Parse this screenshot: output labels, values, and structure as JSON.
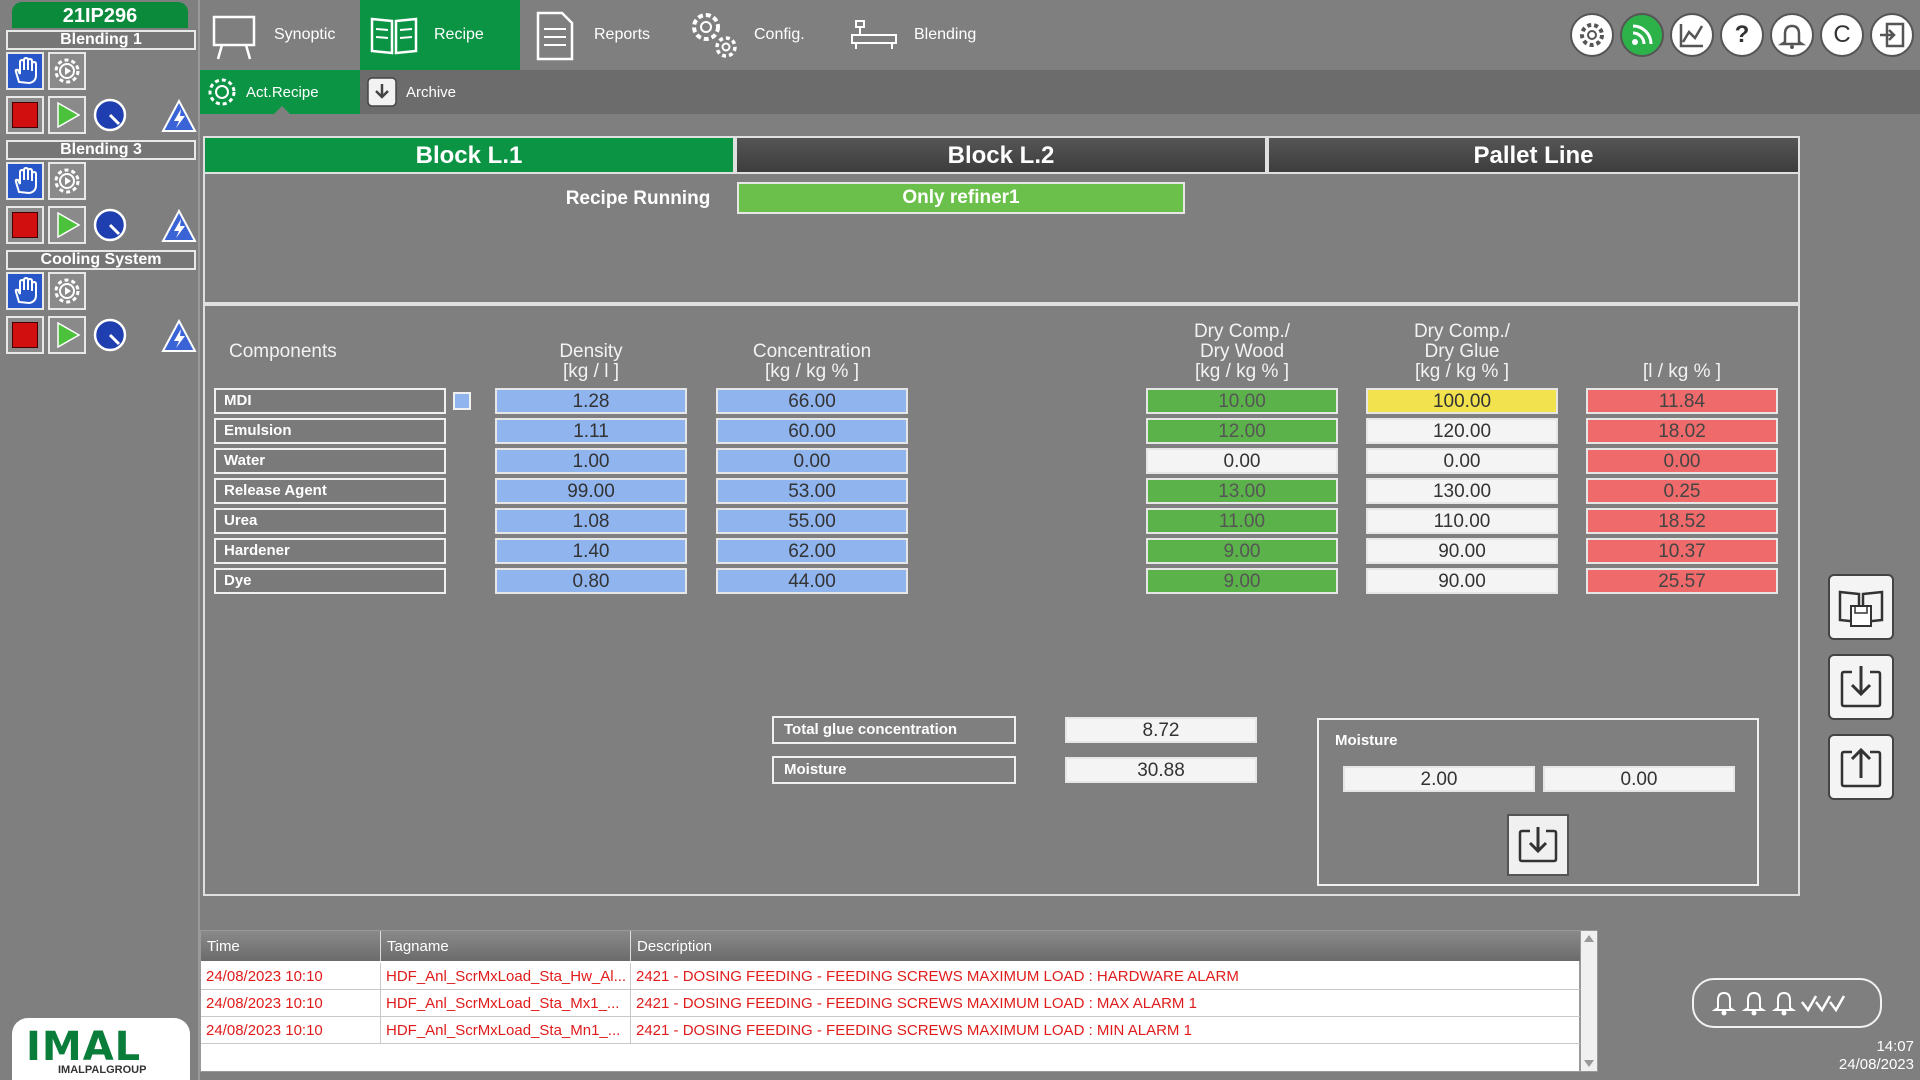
{
  "plant_id": "21IP296",
  "groups": [
    {
      "label": "Blending 1"
    },
    {
      "label": "Blending 3"
    },
    {
      "label": "Cooling System"
    }
  ],
  "logo": {
    "main": "IMAL",
    "sub": "IMALPALGROUP"
  },
  "nav": {
    "synoptic": "Synoptic",
    "recipe": "Recipe",
    "reports": "Reports",
    "config": "Config.",
    "blending": "Blending",
    "user_initial": "C"
  },
  "subnav": {
    "act_recipe": "Act.Recipe",
    "archive": "Archive"
  },
  "line_tabs": [
    "Block L.1",
    "Block L.2",
    "Pallet Line"
  ],
  "recipe_status": {
    "label": "Recipe Running",
    "value": "Only refiner1"
  },
  "table": {
    "headers": {
      "components": "Components",
      "density": [
        "Density",
        "[kg / l ]"
      ],
      "concentration": [
        "Concentration",
        "[kg / kg % ]"
      ],
      "dry_wood": [
        "Dry Comp./",
        "Dry Wood",
        "[kg / kg % ]"
      ],
      "dry_glue": [
        "Dry Comp./",
        "Dry Glue",
        "[kg / kg % ]"
      ],
      "l_kg": "[l / kg % ]"
    },
    "rows": [
      {
        "name": "MDI",
        "density": "1.28",
        "concentration": "66.00",
        "dry_wood": "10.00",
        "dry_glue": "100.00",
        "l_kg": "11.84"
      },
      {
        "name": "Emulsion",
        "density": "1.11",
        "concentration": "60.00",
        "dry_wood": "12.00",
        "dry_glue": "120.00",
        "l_kg": "18.02"
      },
      {
        "name": "Water",
        "density": "1.00",
        "concentration": "0.00",
        "dry_wood": "0.00",
        "dry_glue": "0.00",
        "l_kg": "0.00"
      },
      {
        "name": "Release Agent",
        "density": "99.00",
        "concentration": "53.00",
        "dry_wood": "13.00",
        "dry_glue": "130.00",
        "l_kg": "0.25"
      },
      {
        "name": "Urea",
        "density": "1.08",
        "concentration": "55.00",
        "dry_wood": "11.00",
        "dry_glue": "110.00",
        "l_kg": "18.52"
      },
      {
        "name": "Hardener",
        "density": "1.40",
        "concentration": "62.00",
        "dry_wood": "9.00",
        "dry_glue": "90.00",
        "l_kg": "10.37"
      },
      {
        "name": "Dye",
        "density": "0.80",
        "concentration": "44.00",
        "dry_wood": "9.00",
        "dry_glue": "90.00",
        "l_kg": "25.57"
      }
    ]
  },
  "summary": {
    "total_glue_label": "Total glue concentration",
    "total_glue_value": "8.72",
    "moisture_label": "Moisture",
    "moisture_value": "30.88"
  },
  "moisture_box": {
    "title": "Moisture",
    "value1": "2.00",
    "value2": "0.00"
  },
  "alarms": {
    "headers": {
      "time": "Time",
      "tagname": "Tagname",
      "description": "Description"
    },
    "rows": [
      {
        "time": "24/08/2023 10:10",
        "tagname": "HDF_Anl_ScrMxLoad_Sta_Hw_Al...",
        "description": "2421 - DOSING FEEDING - FEEDING SCREWS MAXIMUM LOAD : HARDWARE ALARM"
      },
      {
        "time": "24/08/2023 10:10",
        "tagname": "HDF_Anl_ScrMxLoad_Sta_Mx1_...",
        "description": "2421 - DOSING FEEDING - FEEDING SCREWS MAXIMUM LOAD : MAX ALARM 1"
      },
      {
        "time": "24/08/2023 10:10",
        "tagname": "HDF_Anl_ScrMxLoad_Sta_Mn1_...",
        "description": "2421 - DOSING FEEDING - FEEDING SCREWS MAXIMUM LOAD : MIN ALARM 1"
      }
    ]
  },
  "clock": {
    "time": "14:07",
    "date": "24/08/2023"
  },
  "colors": {
    "accent_green": "#0b9444",
    "alarm_red": "#e01b1b",
    "cell_blue": "#8fb4ee",
    "cell_green": "#5cb24a",
    "cell_red": "#ef6b6b",
    "cell_yellow": "#f1e24e"
  }
}
